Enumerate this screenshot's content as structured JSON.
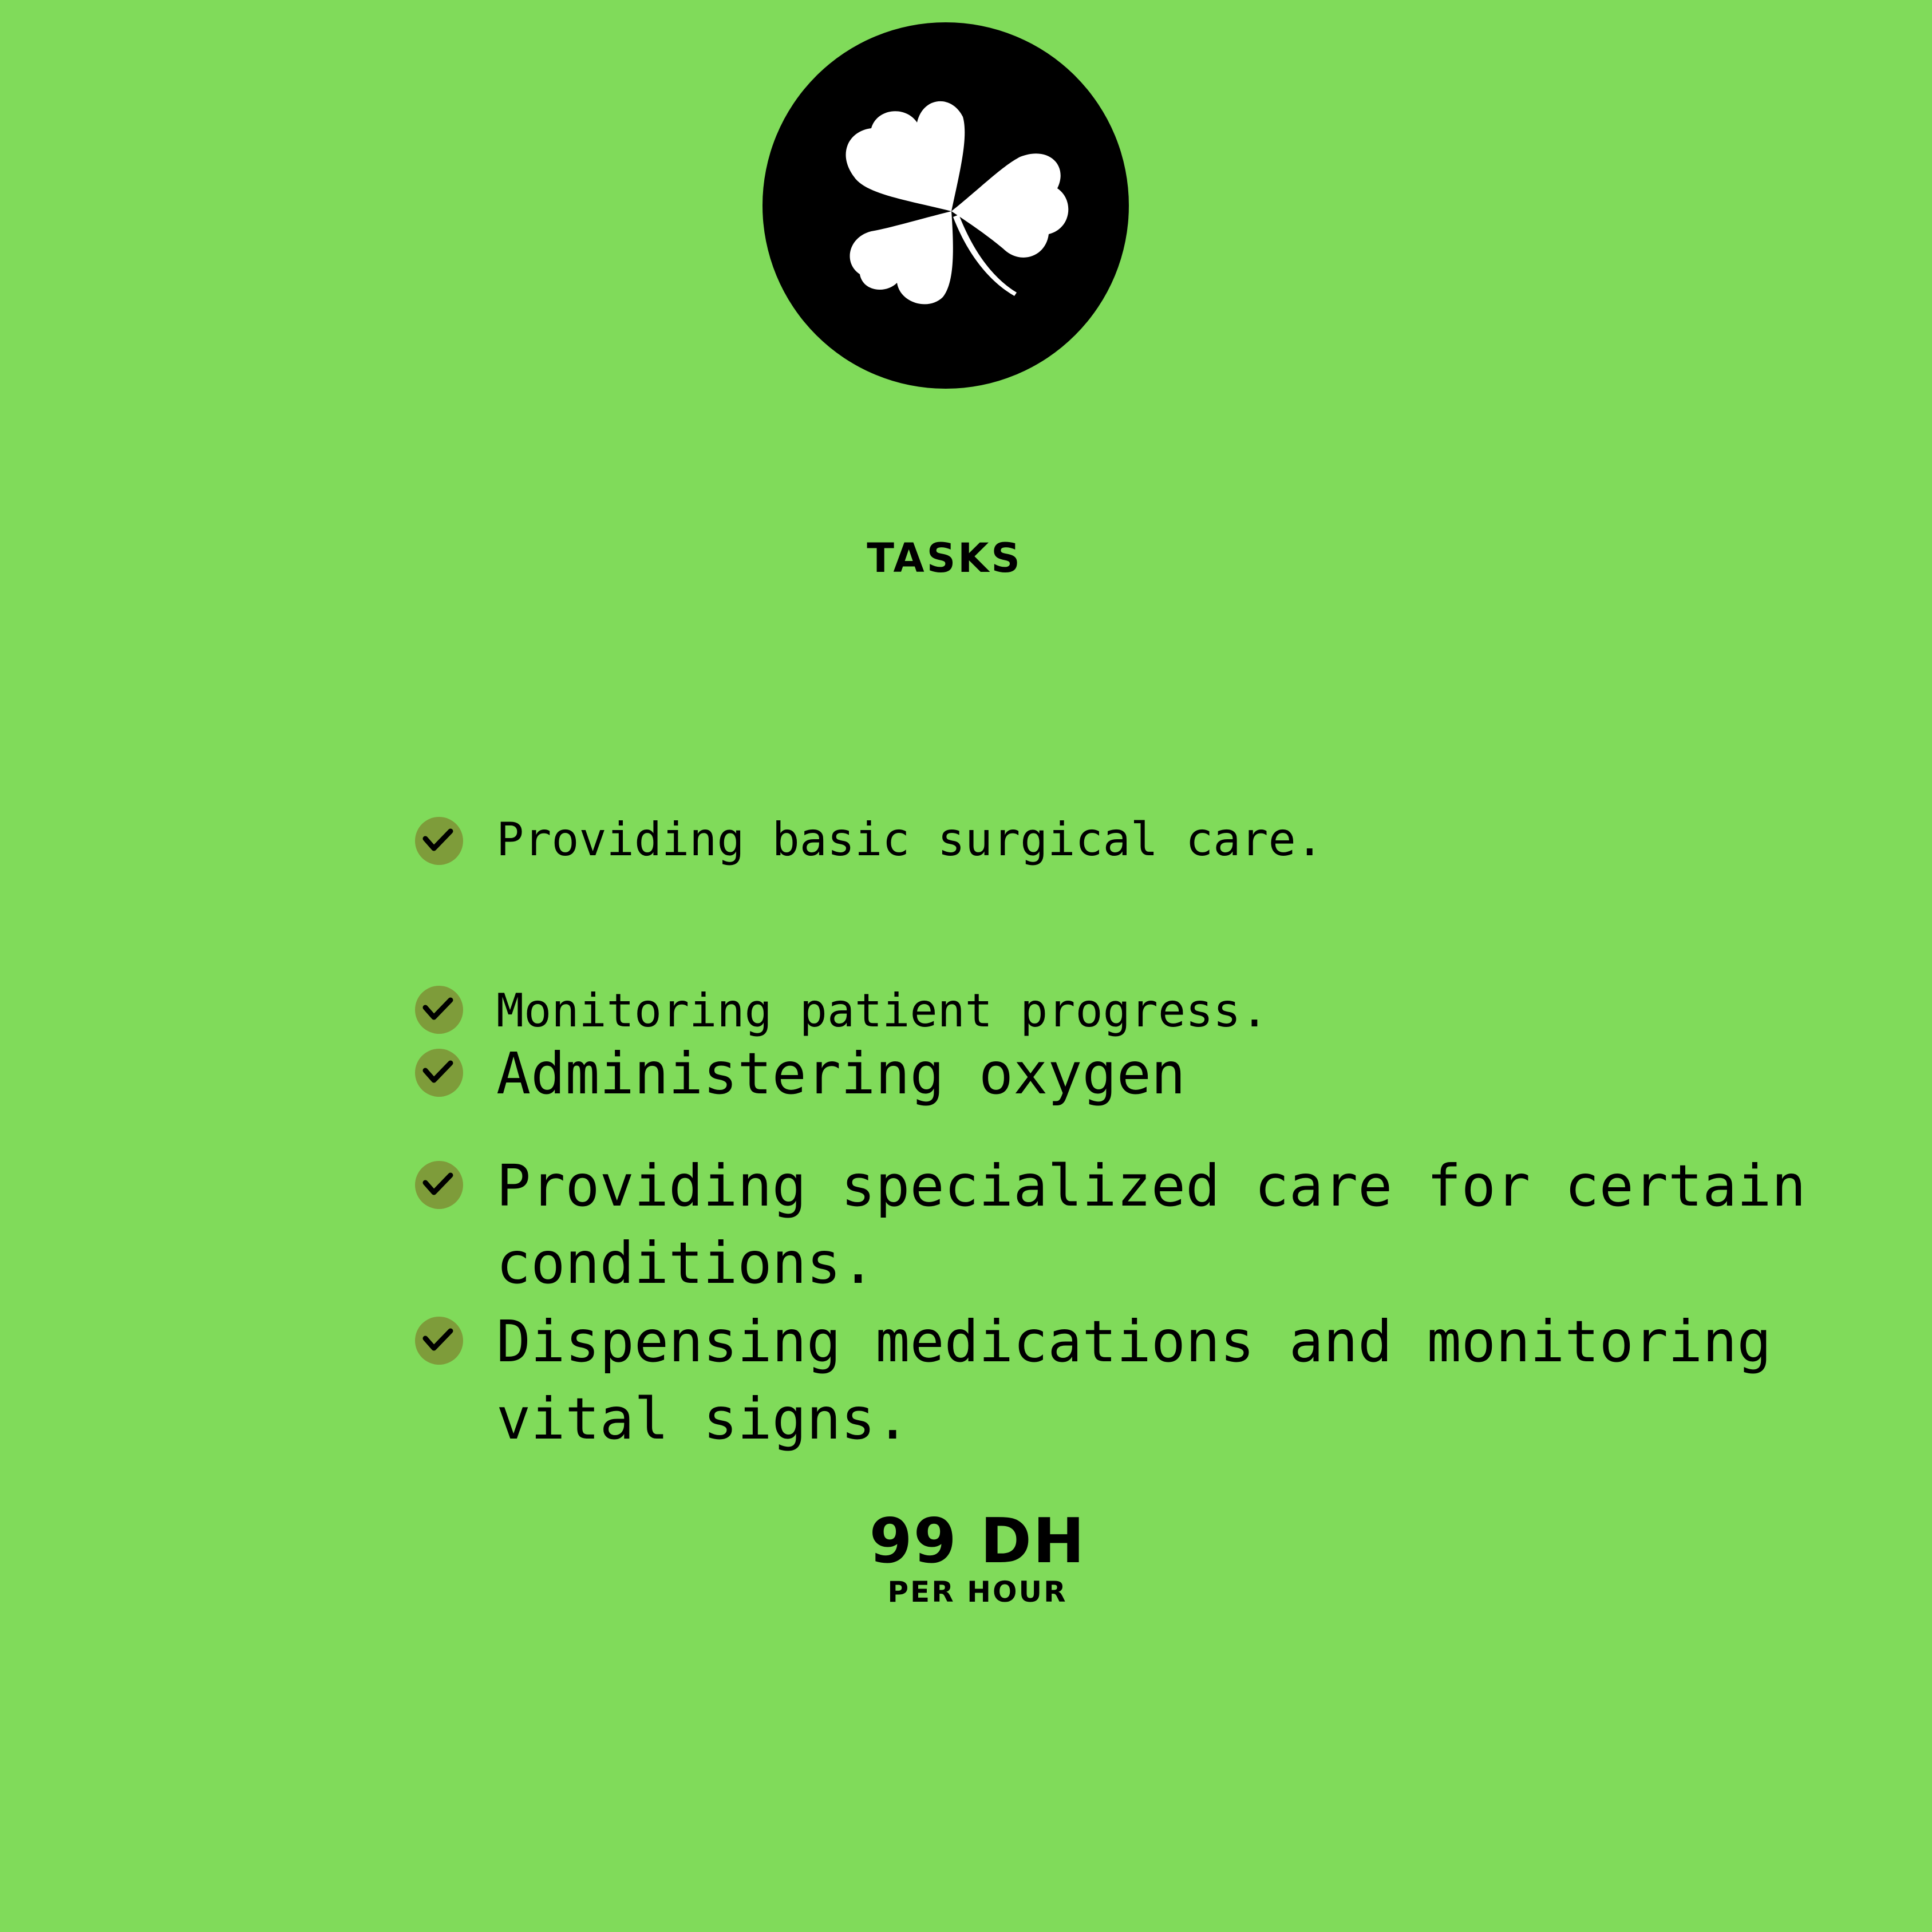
{
  "logo": {
    "icon": "shamrock-icon"
  },
  "title": "TASKS",
  "tasks": [
    {
      "text": "Providing basic surgical care."
    },
    {
      "text": "Monitoring patient progress."
    },
    {
      "text": "Administering oxygen"
    },
    {
      "line1": "Providing specialized care for certain",
      "line2": "conditions."
    },
    {
      "line1": "Dispensing medications and monitoring",
      "line2": "vital signs."
    }
  ],
  "price": {
    "amount": "99 DH",
    "unit": "PER HOUR"
  },
  "colors": {
    "background": "#80db5a",
    "check": "#7e9c3a",
    "text": "#000000"
  }
}
